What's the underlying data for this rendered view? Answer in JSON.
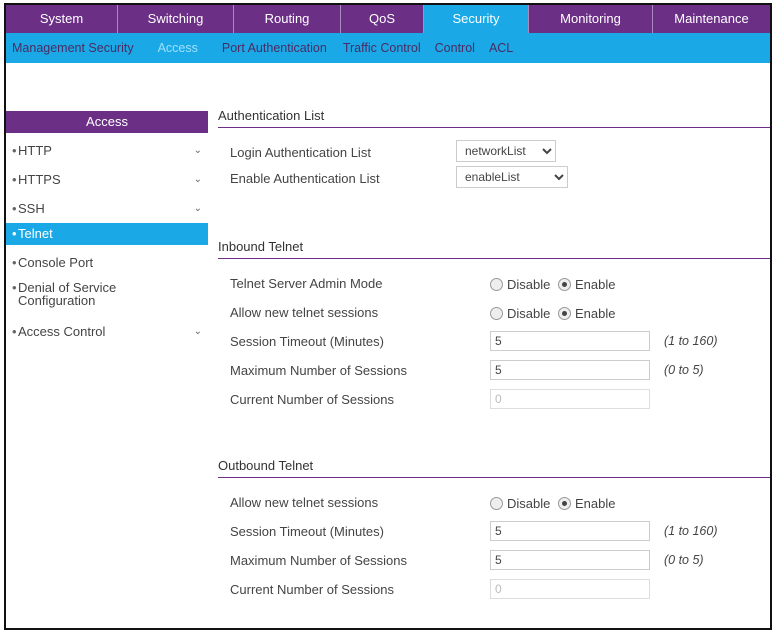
{
  "topnav": {
    "tabs": [
      {
        "label": "System",
        "width": 112
      },
      {
        "label": "Switching",
        "width": 116
      },
      {
        "label": "Routing",
        "width": 107
      },
      {
        "label": "QoS",
        "width": 83
      },
      {
        "label": "Security",
        "width": 105,
        "active": true
      },
      {
        "label": "Monitoring",
        "width": 124
      },
      {
        "label": "Maintenance",
        "width": 117
      }
    ]
  },
  "subnav": {
    "items": [
      {
        "label": "Management Security"
      },
      {
        "label": "Access",
        "active": true
      },
      {
        "label": "Port Authentication"
      },
      {
        "label": "Traffic Control"
      },
      {
        "label": "Control"
      },
      {
        "label": "ACL"
      }
    ]
  },
  "sidebar": {
    "title": "Access",
    "items": [
      {
        "label": "HTTP",
        "chevron": true
      },
      {
        "label": "HTTPS",
        "chevron": true
      },
      {
        "label": "SSH",
        "chevron": true
      },
      {
        "label": "Telnet",
        "active": true
      },
      {
        "label": "Console Port"
      },
      {
        "label": "Denial of Service Configuration",
        "two_line": true
      },
      {
        "label": "Access Control",
        "chevron": true
      }
    ]
  },
  "auth": {
    "title": "Authentication List",
    "login_label": "Login Authentication List",
    "login_value": "networkList",
    "enable_label": "Enable Authentication List",
    "enable_value": "enableList"
  },
  "inbound": {
    "title": "Inbound Telnet",
    "admin_mode_label": "Telnet Server Admin Mode",
    "allow_label": "Allow new telnet sessions",
    "disable_label": "Disable",
    "enable_label": "Enable",
    "timeout_label": "Session Timeout (Minutes)",
    "timeout_value": "5",
    "timeout_hint": "(1 to 160)",
    "max_label": "Maximum Number of Sessions",
    "max_value": "5",
    "max_hint": "(0 to 5)",
    "current_label": "Current Number of Sessions",
    "current_value": "0"
  },
  "outbound": {
    "title": "Outbound Telnet",
    "allow_label": "Allow new telnet sessions",
    "disable_label": "Disable",
    "enable_label": "Enable",
    "timeout_label": "Session Timeout (Minutes)",
    "timeout_value": "5",
    "timeout_hint": "(1 to 160)",
    "max_label": "Maximum Number of Sessions",
    "max_value": "5",
    "max_hint": "(0 to 5)",
    "current_label": "Current Number of Sessions",
    "current_value": "0"
  }
}
